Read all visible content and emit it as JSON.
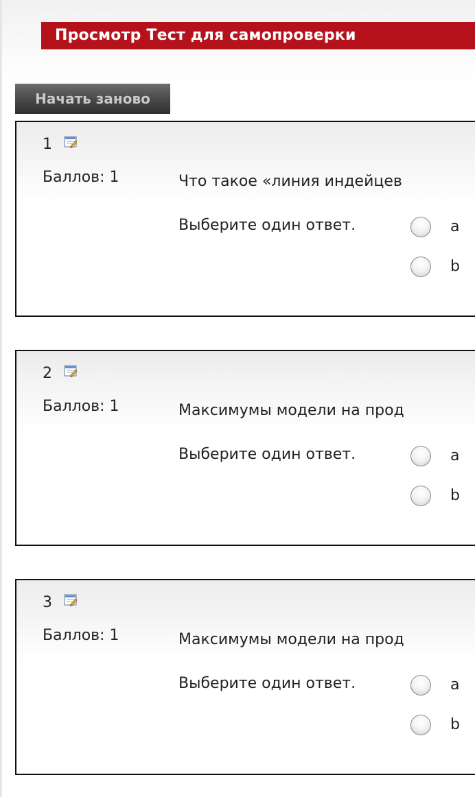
{
  "header": {
    "title": "Просмотр Тест для самопроверки",
    "restart_label": "Начать заново"
  },
  "questions": [
    {
      "number": "1",
      "grade": "Баллов: 1",
      "text": "Что такое «линия индейцев",
      "prompt": "Выберите один ответ.",
      "options": [
        "a",
        "b"
      ]
    },
    {
      "number": "2",
      "grade": "Баллов: 1",
      "text": "Максимумы модели на прод",
      "prompt": "Выберите один ответ.",
      "options": [
        "a",
        "b"
      ]
    },
    {
      "number": "3",
      "grade": "Баллов: 1",
      "text": "Максимумы модели на прод",
      "prompt": "Выберите один ответ.",
      "options": [
        "a",
        "b"
      ]
    }
  ],
  "colors": {
    "title_bar": "#b5121b",
    "restart_button": "#4a4a4a",
    "border": "#111111"
  },
  "icons": {
    "edit": "edit-icon",
    "radio": "radio-button"
  }
}
